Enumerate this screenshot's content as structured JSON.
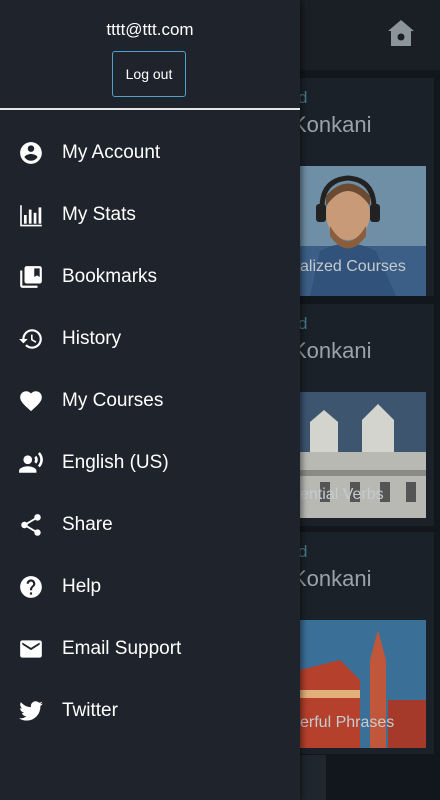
{
  "account": {
    "email": "tttt@ttt.com",
    "logout_label": "Log out"
  },
  "menu": [
    {
      "label": "My Account",
      "icon": "account-circle-icon"
    },
    {
      "label": "My Stats",
      "icon": "stats-bars-icon"
    },
    {
      "label": "Bookmarks",
      "icon": "bookmarks-icon"
    },
    {
      "label": "History",
      "icon": "history-icon"
    },
    {
      "label": "My Courses",
      "icon": "heart-icon"
    },
    {
      "label": "English (US)",
      "icon": "speaking-person-icon"
    },
    {
      "label": "Share",
      "icon": "share-icon"
    },
    {
      "label": "Help",
      "icon": "help-icon"
    },
    {
      "label": "Email Support",
      "icon": "email-icon"
    },
    {
      "label": "Twitter",
      "icon": "twitter-icon"
    }
  ],
  "background_cards": [
    {
      "tag": "d",
      "title": "Konkani",
      "caption": "alized Courses"
    },
    {
      "tag": "d",
      "title": "Konkani",
      "caption": "ential Verbs"
    },
    {
      "tag": "d",
      "title": "Konkani",
      "caption": "erful Phrases"
    }
  ],
  "colors": {
    "drawer_bg": "#1f232b",
    "accent_border": "#4fa3c7",
    "text": "#ffffff"
  }
}
